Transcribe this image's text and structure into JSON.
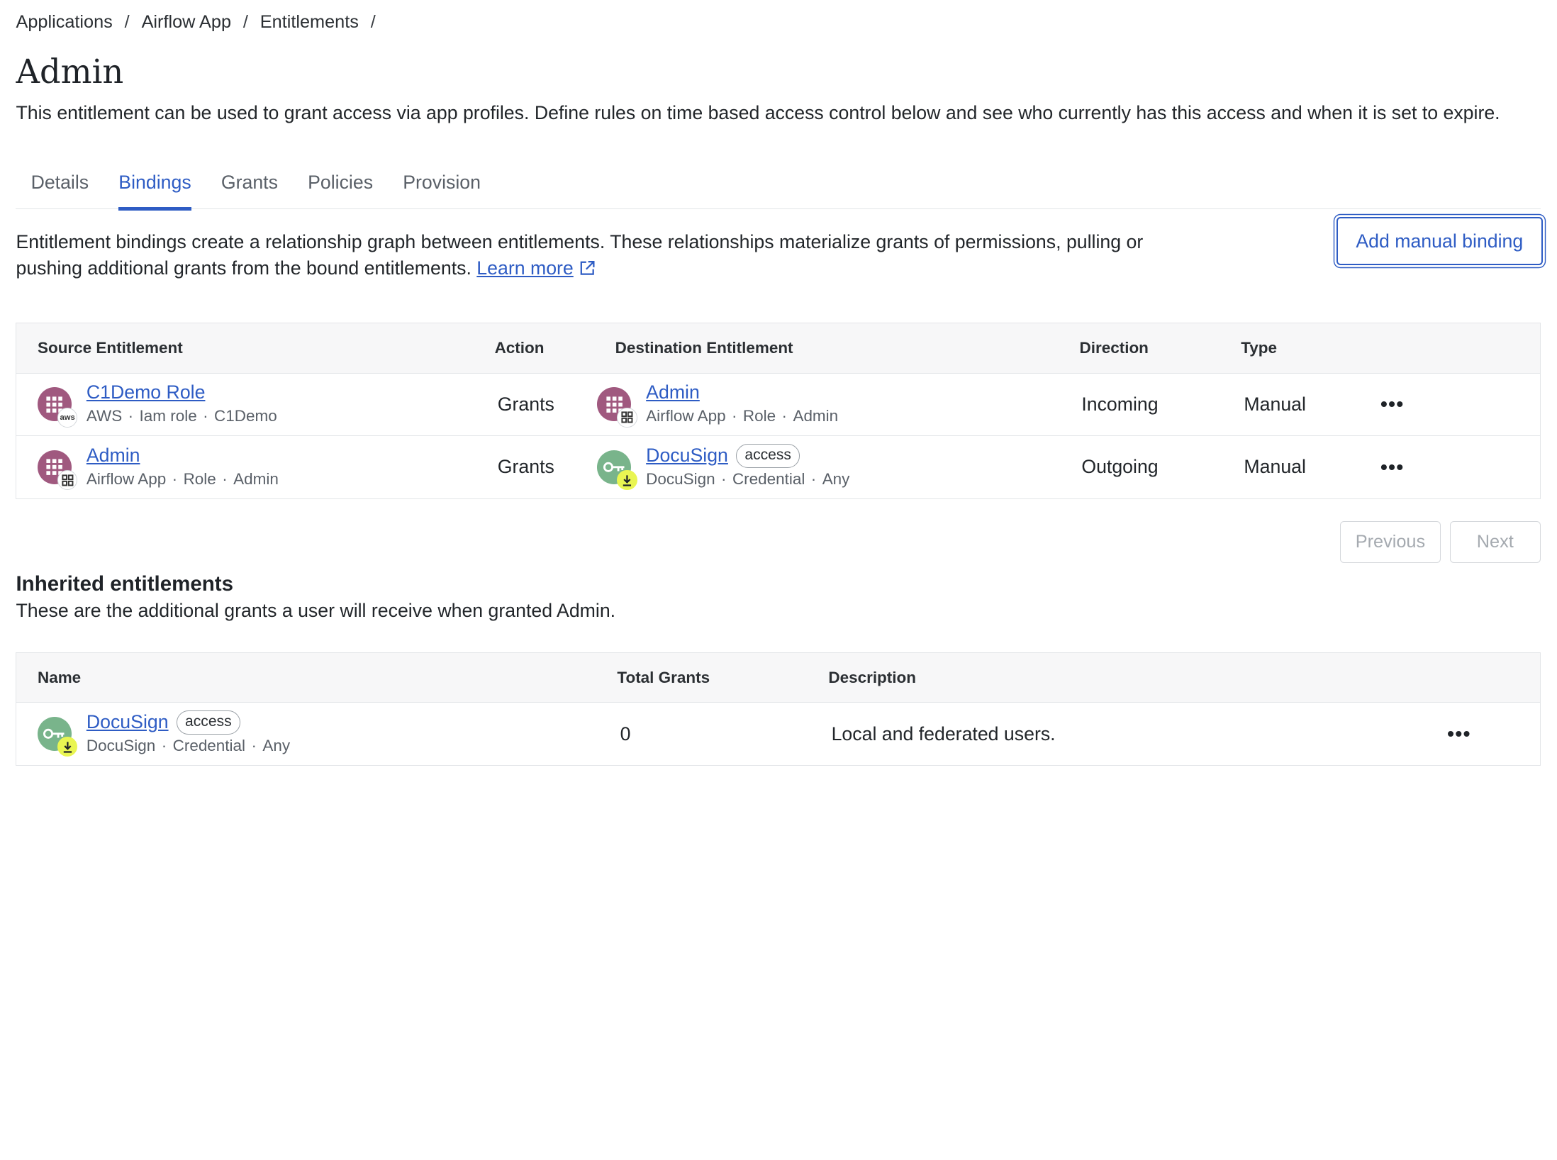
{
  "breadcrumb": [
    "Applications",
    "Airflow App",
    "Entitlements"
  ],
  "page": {
    "title": "Admin",
    "description": "This entitlement can be used to grant access via app profiles. Define rules on time based access control below and see who currently has this access and when it is set to expire."
  },
  "tabs": [
    "Details",
    "Bindings",
    "Grants",
    "Policies",
    "Provision"
  ],
  "active_tab": "Bindings",
  "bindings": {
    "intro": "Entitlement bindings create a relationship graph between entitlements. These relationships materialize grants of permissions, pulling or pushing additional grants from the bound entitlements. ",
    "learn_more": "Learn more",
    "add_button": "Add manual binding",
    "columns": [
      "Source Entitlement",
      "Action",
      "Destination Entitlement",
      "Direction",
      "Type"
    ],
    "rows": [
      {
        "source": {
          "name": "C1Demo Role",
          "meta": [
            "AWS",
            "Iam role",
            "C1Demo"
          ],
          "badge": "aws"
        },
        "action": "Grants",
        "destination": {
          "name": "Admin",
          "meta": [
            "Airflow App",
            "Role",
            "Admin"
          ]
        },
        "direction": "Incoming",
        "type": "Manual"
      },
      {
        "source": {
          "name": "Admin",
          "meta": [
            "Airflow App",
            "Role",
            "Admin"
          ]
        },
        "action": "Grants",
        "destination": {
          "name": "DocuSign",
          "pill": "access",
          "meta": [
            "DocuSign",
            "Credential",
            "Any"
          ]
        },
        "direction": "Outgoing",
        "type": "Manual"
      }
    ],
    "pager": {
      "previous": "Previous",
      "next": "Next"
    }
  },
  "inherited": {
    "title": "Inherited entitlements",
    "subtitle_prefix": "These are the additional grants a user will receive when granted ",
    "subtitle_entitlement": "Admin",
    "subtitle_suffix": ".",
    "columns": [
      "Name",
      "Total Grants",
      "Description"
    ],
    "rows": [
      {
        "name": "DocuSign",
        "pill": "access",
        "meta": [
          "DocuSign",
          "Credential",
          "Any"
        ],
        "total_grants": "0",
        "description": "Local and federated users."
      }
    ]
  },
  "icons": {
    "more": "more-horizontal-icon",
    "external": "external-link-icon",
    "role_avatar": "grid-icon",
    "credential_avatar": "key-icon"
  },
  "colors": {
    "accent": "#2e5cc4",
    "role_avatar": "#a0597f",
    "credential_avatar": "#79b48b",
    "download_badge": "#e9f552"
  }
}
